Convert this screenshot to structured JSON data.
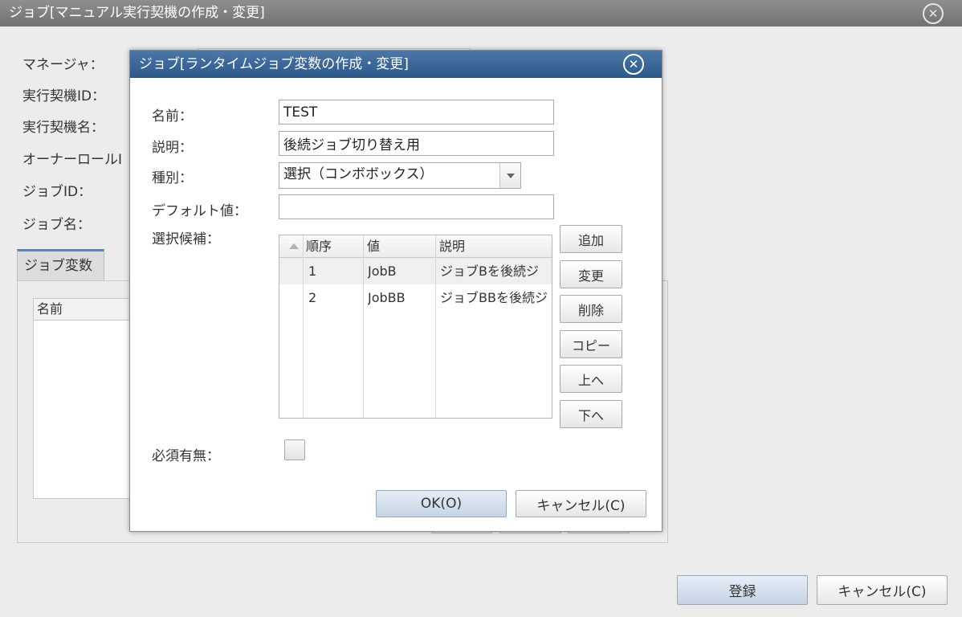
{
  "outer": {
    "title": "ジョブ[マニュアル実行契機の作成・変更]",
    "labels": {
      "manager": "マネージャ：",
      "trigger_id": "実行契機ID：",
      "trigger_name": "実行契機名：",
      "owner_role": "オーナーロールI",
      "job_id": "ジョブID：",
      "job_name": "ジョブ名："
    },
    "tab_label": "ジョブ変数",
    "grid_header_name": "名前",
    "register_label": "登録",
    "cancel_label": "キャンセル(C)"
  },
  "dialog": {
    "title": "ジョブ[ランタイムジョブ変数の作成・変更]",
    "labels": {
      "name": "名前：",
      "description": "説明：",
      "type": "種別：",
      "default_value": "デフォルト値：",
      "candidates": "選択候補：",
      "required": "必須有無："
    },
    "fields": {
      "name_value": "TEST",
      "description_value": "後続ジョブ切り替え用",
      "type_selected": "選択（コンボボックス）",
      "default_value": ""
    },
    "grid": {
      "columns": [
        "順序",
        "値",
        "説明"
      ],
      "rows": [
        {
          "order": "1",
          "value": "JobB",
          "description": "ジョブBを後続ジ"
        },
        {
          "order": "2",
          "value": "JobBB",
          "description": "ジョブBBを後続ジ"
        }
      ]
    },
    "side_buttons": {
      "add": "追加",
      "edit": "変更",
      "delete": "削除",
      "copy": "コピー",
      "up": "上へ",
      "down": "下へ"
    },
    "required_checked": false,
    "ok_label": "OK(O)",
    "cancel_label": "キャンセル(C)"
  },
  "icons": {
    "close": "close-icon",
    "dropdown": "chevron-down-icon",
    "sort": "sort-ascending-icon"
  },
  "colors": {
    "dialog_title_bg": "#3a679b",
    "outer_title_bg": "#808080",
    "primary_button": "#cfdbea"
  }
}
